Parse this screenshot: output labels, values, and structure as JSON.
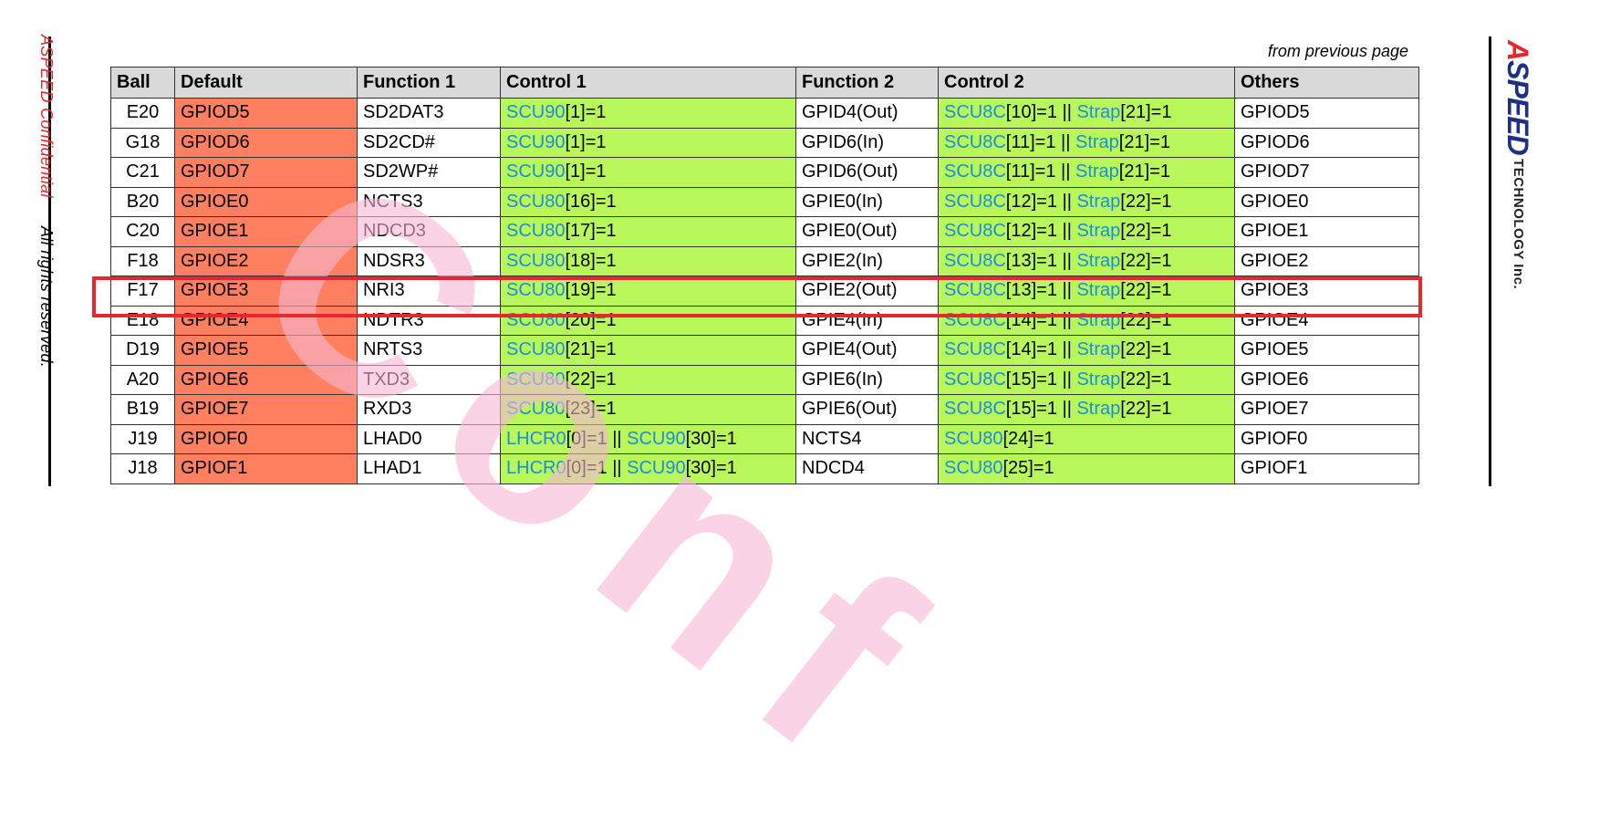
{
  "sidebar": {
    "confidential": "ASPEED Confidential",
    "rights": "All rights reserved."
  },
  "logo": {
    "brand": "ASPEED",
    "brand_first": "A",
    "brand_rest": "SPEED",
    "sub": "TECHNOLOGY Inc."
  },
  "continued_label": "from previous page",
  "watermark_text": "Conf",
  "table": {
    "headers": [
      "Ball",
      "Default",
      "Function 1",
      "Control 1",
      "Function 2",
      "Control 2",
      "Others"
    ],
    "rows": [
      {
        "ball": "E20",
        "default": "GPIOD5",
        "f1": "SD2DAT3",
        "c1": [
          {
            "t": "SCU90",
            "r": true
          },
          {
            "t": "[1]=1"
          }
        ],
        "f2": "GPID4(Out)",
        "c2": [
          {
            "t": "SCU8C",
            "r": true
          },
          {
            "t": "[10]=1 "
          },
          {
            "t": "||",
            "s": true
          },
          {
            "t": " "
          },
          {
            "t": "Strap",
            "r": true
          },
          {
            "t": "[21]=1"
          }
        ],
        "others": "GPIOD5"
      },
      {
        "ball": "G18",
        "default": "GPIOD6",
        "f1": "SD2CD#",
        "c1": [
          {
            "t": "SCU90",
            "r": true
          },
          {
            "t": "[1]=1"
          }
        ],
        "f2": "GPID6(In)",
        "c2": [
          {
            "t": "SCU8C",
            "r": true
          },
          {
            "t": "[11]=1 "
          },
          {
            "t": "||",
            "s": true
          },
          {
            "t": " "
          },
          {
            "t": "Strap",
            "r": true
          },
          {
            "t": "[21]=1"
          }
        ],
        "others": "GPIOD6"
      },
      {
        "ball": "C21",
        "default": "GPIOD7",
        "f1": "SD2WP#",
        "c1": [
          {
            "t": "SCU90",
            "r": true
          },
          {
            "t": "[1]=1"
          }
        ],
        "f2": "GPID6(Out)",
        "c2": [
          {
            "t": "SCU8C",
            "r": true
          },
          {
            "t": "[11]=1 "
          },
          {
            "t": "||",
            "s": true
          },
          {
            "t": " "
          },
          {
            "t": "Strap",
            "r": true
          },
          {
            "t": "[21]=1"
          }
        ],
        "others": "GPIOD7"
      },
      {
        "ball": "B20",
        "default": "GPIOE0",
        "f1": "NCTS3",
        "c1": [
          {
            "t": "SCU80",
            "r": true
          },
          {
            "t": "[16]=1"
          }
        ],
        "f2": "GPIE0(In)",
        "c2": [
          {
            "t": "SCU8C",
            "r": true
          },
          {
            "t": "[12]=1 "
          },
          {
            "t": "||",
            "s": true
          },
          {
            "t": " "
          },
          {
            "t": "Strap",
            "r": true
          },
          {
            "t": "[22]=1"
          }
        ],
        "others": "GPIOE0"
      },
      {
        "ball": "C20",
        "default": "GPIOE1",
        "f1": "NDCD3",
        "c1": [
          {
            "t": "SCU80",
            "r": true
          },
          {
            "t": "[17]=1"
          }
        ],
        "f2": "GPIE0(Out)",
        "c2": [
          {
            "t": "SCU8C",
            "r": true
          },
          {
            "t": "[12]=1 "
          },
          {
            "t": "||",
            "s": true
          },
          {
            "t": " "
          },
          {
            "t": "Strap",
            "r": true
          },
          {
            "t": "[22]=1"
          }
        ],
        "others": "GPIOE1"
      },
      {
        "ball": "F18",
        "default": "GPIOE2",
        "f1": "NDSR3",
        "c1": [
          {
            "t": "SCU80",
            "r": true
          },
          {
            "t": "[18]=1"
          }
        ],
        "f2": "GPIE2(In)",
        "c2": [
          {
            "t": "SCU8C",
            "r": true
          },
          {
            "t": "[13]=1 "
          },
          {
            "t": "||",
            "s": true
          },
          {
            "t": " "
          },
          {
            "t": "Strap",
            "r": true
          },
          {
            "t": "[22]=1"
          }
        ],
        "others": "GPIOE2"
      },
      {
        "ball": "F17",
        "default": "GPIOE3",
        "f1": "NRI3",
        "c1": [
          {
            "t": "SCU80",
            "r": true
          },
          {
            "t": "[19]=1"
          }
        ],
        "f2": "GPIE2(Out)",
        "c2": [
          {
            "t": "SCU8C",
            "r": true
          },
          {
            "t": "[13]=1 "
          },
          {
            "t": "||",
            "s": true
          },
          {
            "t": " "
          },
          {
            "t": "Strap",
            "r": true
          },
          {
            "t": "[22]=1"
          }
        ],
        "others": "GPIOE3"
      },
      {
        "ball": "E18",
        "default": "GPIOE4",
        "f1": "NDTR3",
        "c1": [
          {
            "t": "SCU80",
            "r": true
          },
          {
            "t": "[20]=1"
          }
        ],
        "f2": "GPIE4(In)",
        "c2": [
          {
            "t": "SCU8C",
            "r": true
          },
          {
            "t": "[14]=1 "
          },
          {
            "t": "||",
            "s": true
          },
          {
            "t": " "
          },
          {
            "t": "Strap",
            "r": true
          },
          {
            "t": "[22]=1"
          }
        ],
        "others": "GPIOE4"
      },
      {
        "ball": "D19",
        "default": "GPIOE5",
        "f1": "NRTS3",
        "c1": [
          {
            "t": "SCU80",
            "r": true
          },
          {
            "t": "[21]=1"
          }
        ],
        "f2": "GPIE4(Out)",
        "c2": [
          {
            "t": "SCU8C",
            "r": true
          },
          {
            "t": "[14]=1 "
          },
          {
            "t": "||",
            "s": true
          },
          {
            "t": " "
          },
          {
            "t": "Strap",
            "r": true
          },
          {
            "t": "[22]=1"
          }
        ],
        "others": "GPIOE5"
      },
      {
        "ball": "A20",
        "default": "GPIOE6",
        "f1": "TXD3",
        "c1": [
          {
            "t": "SCU80",
            "r": true
          },
          {
            "t": "[22]=1"
          }
        ],
        "f2": "GPIE6(In)",
        "c2": [
          {
            "t": "SCU8C",
            "r": true
          },
          {
            "t": "[15]=1 "
          },
          {
            "t": "||",
            "s": true
          },
          {
            "t": " "
          },
          {
            "t": "Strap",
            "r": true
          },
          {
            "t": "[22]=1"
          }
        ],
        "others": "GPIOE6"
      },
      {
        "ball": "B19",
        "default": "GPIOE7",
        "f1": "RXD3",
        "c1": [
          {
            "t": "SCU80",
            "r": true
          },
          {
            "t": "[23]=1"
          }
        ],
        "f2": "GPIE6(Out)",
        "c2": [
          {
            "t": "SCU8C",
            "r": true
          },
          {
            "t": "[15]=1 "
          },
          {
            "t": "||",
            "s": true
          },
          {
            "t": " "
          },
          {
            "t": "Strap",
            "r": true
          },
          {
            "t": "[22]=1"
          }
        ],
        "others": "GPIOE7"
      },
      {
        "ball": "J19",
        "default": "GPIOF0",
        "f1": "LHAD0",
        "c1": [
          {
            "t": "LHCR0",
            "r": true
          },
          {
            "t": "[0]=1 "
          },
          {
            "t": "||",
            "s": true
          },
          {
            "t": " "
          },
          {
            "t": "SCU90",
            "r": true
          },
          {
            "t": "[30]=1"
          }
        ],
        "f2": "NCTS4",
        "c2": [
          {
            "t": "SCU80",
            "r": true
          },
          {
            "t": "[24]=1"
          }
        ],
        "others": "GPIOF0"
      },
      {
        "ball": "J18",
        "default": "GPIOF1",
        "f1": "LHAD1",
        "c1": [
          {
            "t": "LHCR0",
            "r": true
          },
          {
            "t": "[0]=1 "
          },
          {
            "t": "||",
            "s": true
          },
          {
            "t": " "
          },
          {
            "t": "SCU90",
            "r": true
          },
          {
            "t": "[30]=1"
          }
        ],
        "f2": "NDCD4",
        "c2": [
          {
            "t": "SCU80",
            "r": true
          },
          {
            "t": "[25]=1"
          }
        ],
        "others": "GPIOF1"
      }
    ]
  },
  "highlighted_ball": "F17",
  "colors": {
    "default_cell": "#ff8060",
    "control_cell": "#b8f75a",
    "header_cell": "#d9d9d9",
    "register_text": "#1a8fd8",
    "highlight_box": "#e8262d",
    "confidential_text": "#e8262d",
    "logo_blue": "#1e2f86"
  }
}
